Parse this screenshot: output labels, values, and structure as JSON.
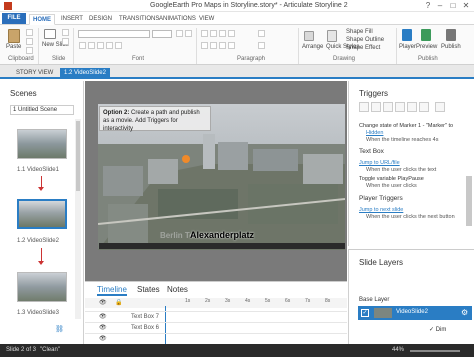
{
  "window": {
    "title": "GoogleEarth Pro Maps in Storyline.story* - Articulate Storyline 2",
    "buttons": [
      "–",
      "□",
      "✕",
      "?"
    ]
  },
  "ribbon_tabs": [
    "FILE",
    "HOME",
    "INSERT",
    "DESIGN",
    "TRANSITIONS",
    "ANIMATIONS",
    "VIEW"
  ],
  "ribbon": {
    "clipboard": {
      "paste": "Paste",
      "label": "Clipboard"
    },
    "slide": {
      "new_slide": "New Slide",
      "label": "Slide"
    },
    "font": {
      "label": "Font"
    },
    "paragraph": {
      "label": "Paragraph"
    },
    "drawing": {
      "arrange": "Arrange",
      "quick_styles": "Quick Styles",
      "shape_fill": "Shape Fill",
      "shape_outline": "Shape Outline",
      "shape_effect": "Shape Effect",
      "label": "Drawing"
    },
    "publish": {
      "player": "Player",
      "preview": "Preview",
      "publish": "Publish",
      "label": "Publish"
    }
  },
  "doc_tabs": [
    "STORY VIEW",
    "1.2 VideoSlide2"
  ],
  "scenes": {
    "title": "Scenes",
    "dropdown": "1 Untitled Scene",
    "items": [
      {
        "label": "1.1 VideoSlide1"
      },
      {
        "label": "1.2 VideoSlide2"
      },
      {
        "label": "1.3 VideoSlide3"
      }
    ]
  },
  "slide": {
    "callout_bold": "Option 2:",
    "callout_text": "Create a path and publish as a movie. Add Triggers for interactivity",
    "caption": "Alexanderplatz",
    "ghost_caption": "Berlin Te... n Island"
  },
  "timeline": {
    "tabs": [
      "Timeline",
      "States",
      "Notes"
    ],
    "ticks": [
      "1s",
      "2s",
      "3s",
      "4s",
      "5s",
      "6s",
      "7s",
      "8s"
    ],
    "rows": [
      "Text Box 7",
      "Text Box 6"
    ]
  },
  "triggers": {
    "title": "Triggers",
    "items": [
      {
        "text": "Change state of Marker 1 - \"Marker\" to",
        "style": "normal"
      },
      {
        "text": "Hidden",
        "style": "link"
      },
      {
        "text": "When the timeline reaches 4s",
        "style": "sub"
      },
      {
        "text": "Text Box",
        "style": "bold"
      },
      {
        "text": "Jump to URL/file",
        "style": "link"
      },
      {
        "text": "When the user clicks the text",
        "style": "sub"
      },
      {
        "text": "Toggle variable PlayPause",
        "style": "normal"
      },
      {
        "text": "When the user clicks",
        "style": "sub"
      },
      {
        "text": "Player Triggers",
        "style": "bold"
      },
      {
        "text": "Jump to next slide",
        "style": "link"
      },
      {
        "text": "When the user clicks the next button",
        "style": "sub"
      }
    ]
  },
  "layers": {
    "title": "Slide Layers",
    "base_label": "Base Layer",
    "layer_name": "VideoSlide2",
    "dim": "Dim"
  },
  "status": {
    "slide": "Slide 2 of 3",
    "theme": "\"Clean\"",
    "zoom": "44%"
  },
  "colors": {
    "accent": "#2a7dc4",
    "file_tab": "#2a6ebb",
    "status_bg": "#2a2a2a"
  }
}
